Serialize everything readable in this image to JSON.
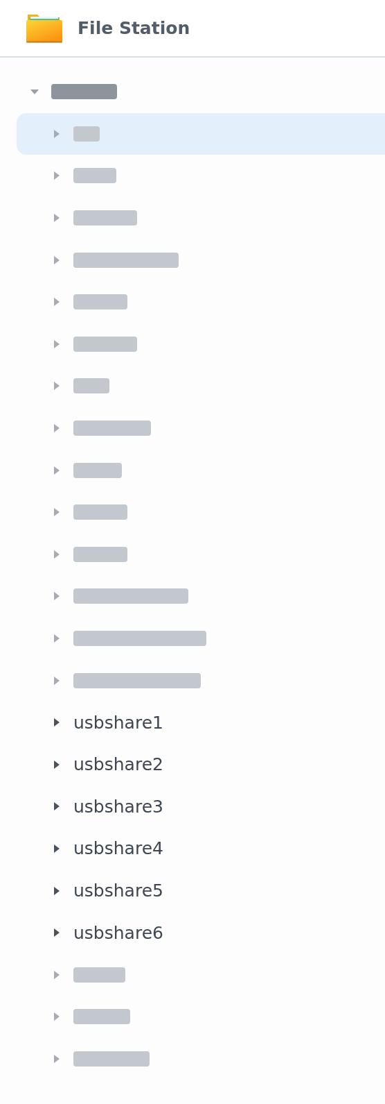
{
  "header": {
    "title": "File Station"
  },
  "tree": {
    "redacted": true,
    "expanded": true,
    "children": [
      {
        "kind": "redacted",
        "selected": true
      },
      {
        "kind": "redacted",
        "selected": false
      },
      {
        "kind": "redacted",
        "selected": false
      },
      {
        "kind": "redacted",
        "selected": false
      },
      {
        "kind": "redacted",
        "selected": false
      },
      {
        "kind": "redacted",
        "selected": false
      },
      {
        "kind": "redacted",
        "selected": false
      },
      {
        "kind": "redacted",
        "selected": false
      },
      {
        "kind": "redacted",
        "selected": false
      },
      {
        "kind": "redacted",
        "selected": false
      },
      {
        "kind": "redacted",
        "selected": false
      },
      {
        "kind": "redacted",
        "selected": false
      },
      {
        "kind": "redacted",
        "selected": false
      },
      {
        "kind": "redacted",
        "selected": false
      },
      {
        "kind": "folder",
        "label": "usbshare1",
        "selected": false
      },
      {
        "kind": "folder",
        "label": "usbshare2",
        "selected": false
      },
      {
        "kind": "folder",
        "label": "usbshare3",
        "selected": false
      },
      {
        "kind": "folder",
        "label": "usbshare4",
        "selected": false
      },
      {
        "kind": "folder",
        "label": "usbshare5",
        "selected": false
      },
      {
        "kind": "folder",
        "label": "usbshare6",
        "selected": false
      },
      {
        "kind": "redacted",
        "selected": false
      },
      {
        "kind": "redacted",
        "selected": false
      },
      {
        "kind": "redacted",
        "selected": false
      }
    ]
  }
}
